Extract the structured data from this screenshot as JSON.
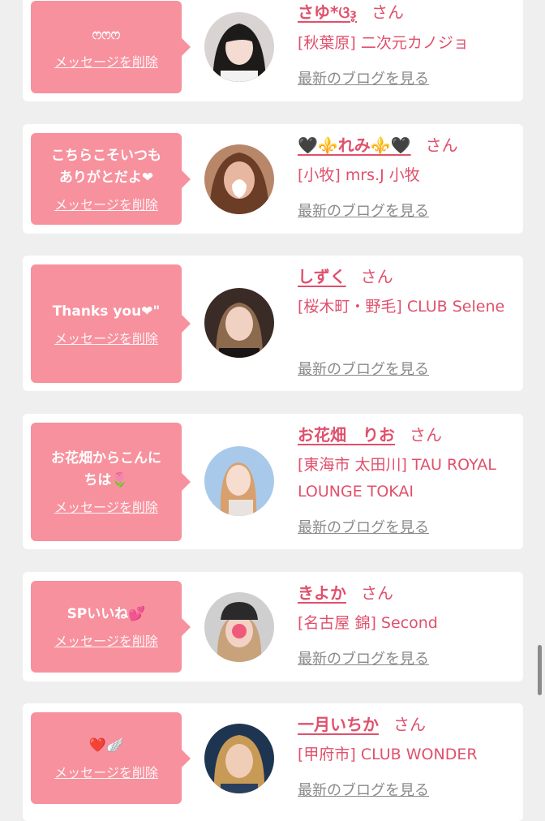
{
  "delete_label": "メッセージを削除",
  "san_label": "さん",
  "blog_label": "最新のブログを見る",
  "colors": {
    "bubble": "#f7919e",
    "accent": "#e0506c",
    "link_gray": "#8a8a8a",
    "background": "#efefef"
  },
  "cards": [
    {
      "message": "ෆෆෆ",
      "name": "さゆ*ଓ₃̥",
      "shop": "[秋葉原] 二次元カノジョ",
      "avatar_icon": "woman-photo-icon"
    },
    {
      "message": "こちらこそいつも\nありがとだよ❤︎",
      "name": "🖤⚜️れみ⚜️🖤",
      "shop": "[小牧] mrs.J 小牧",
      "avatar_icon": "woman-photo-icon"
    },
    {
      "message": "Thanks you❤︎\"",
      "name": "しずく",
      "shop": "[桜木町・野毛] CLUB Selene",
      "avatar_icon": "woman-photo-icon"
    },
    {
      "message": "お花畑からこんに\nちは🌷",
      "name": "お花畑　りお",
      "shop": "[東海市 太田川] TAU ROYAL LOUNGE TOKAI",
      "avatar_icon": "woman-photo-icon"
    },
    {
      "message": "SPいいね💕",
      "name": "きよか",
      "shop": "[名古屋 錦] Second",
      "avatar_icon": "woman-photo-icon"
    },
    {
      "message": "❤️🪽",
      "name": "一月いちか",
      "shop": "[甲府市] CLUB WONDER",
      "avatar_icon": "woman-photo-icon"
    }
  ]
}
